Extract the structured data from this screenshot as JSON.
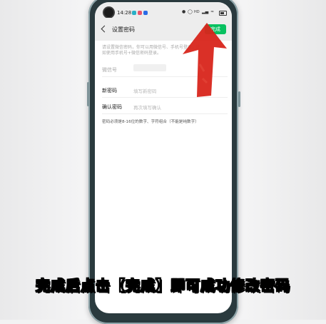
{
  "status_bar": {
    "time": "14:28",
    "app_icon_colors": [
      "#2ab0c6",
      "#e9546b",
      "#2b6be6"
    ],
    "icons": [
      "lock-icon",
      "alarm-icon",
      "hd-icon",
      "signal-icon",
      "wifi-icon",
      "battery-icon"
    ]
  },
  "header": {
    "title": "设置密码",
    "done_label": "完成"
  },
  "description": "请设置微信密码，你可以用微信号、手机号登录，比如使用手机号+微信密码登录。",
  "form": {
    "wechat_id_label": "微信号",
    "new_password_label": "新密码",
    "new_password_placeholder": "填写新密码",
    "confirm_password_label": "确认密码",
    "confirm_password_placeholder": "再次填写确认"
  },
  "hint": "密码必须是8-16位的数字、字符组合（不能是纯数字）",
  "annotation": {
    "arrow_color": "#d8251b"
  },
  "caption": "完成后点击【完成】即可成功修改密码",
  "colors": {
    "accent_green": "#07c160",
    "phone_frame": "#2a3a3e"
  }
}
